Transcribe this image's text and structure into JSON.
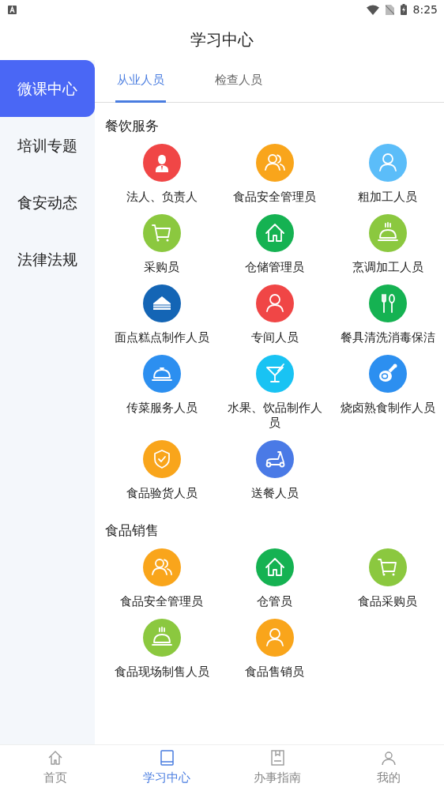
{
  "status_bar": {
    "time": "8:25"
  },
  "header": {
    "title": "学习中心"
  },
  "sidebar": {
    "items": [
      {
        "label": "微课中心",
        "selected": true
      },
      {
        "label": "培训专题",
        "selected": false
      },
      {
        "label": "食安动态",
        "selected": false
      },
      {
        "label": "法律法规",
        "selected": false
      }
    ]
  },
  "tabs": [
    {
      "label": "从业人员",
      "selected": true
    },
    {
      "label": "检查人员",
      "selected": false
    }
  ],
  "sections": [
    {
      "title": "餐饮服务",
      "items": [
        {
          "label": "法人、负责人",
          "kind": "manager",
          "color": "#f04646"
        },
        {
          "label": "食品安全管理员",
          "kind": "group",
          "color": "#f9a51b"
        },
        {
          "label": "粗加工人员",
          "kind": "person",
          "color": "#5bbdf9"
        },
        {
          "label": "采购员",
          "kind": "cart",
          "color": "#8bc83f"
        },
        {
          "label": "仓储管理员",
          "kind": "house",
          "color": "#15b252"
        },
        {
          "label": "烹调加工人员",
          "kind": "steam",
          "color": "#8bc83f"
        },
        {
          "label": "面点糕点制作人员",
          "kind": "cake",
          "color": "#1465b5"
        },
        {
          "label": "专间人员",
          "kind": "person",
          "color": "#f04646"
        },
        {
          "label": "餐具清洗消毒保洁",
          "kind": "utensils",
          "color": "#15b252"
        },
        {
          "label": "传菜服务人员",
          "kind": "cloche",
          "color": "#2c8ff0"
        },
        {
          "label": "水果、饮品制作人员",
          "kind": "cocktail",
          "color": "#19c3f3"
        },
        {
          "label": "烧卤熟食制作人员",
          "kind": "ham",
          "color": "#2c8ff0"
        },
        {
          "label": "食品验货人员",
          "kind": "shield",
          "color": "#f9a51b"
        },
        {
          "label": "送餐人员",
          "kind": "scooter",
          "color": "#4a7ae6"
        }
      ]
    },
    {
      "title": "食品销售",
      "items": [
        {
          "label": "食品安全管理员",
          "kind": "group",
          "color": "#f9a51b"
        },
        {
          "label": "仓管员",
          "kind": "house",
          "color": "#15b252"
        },
        {
          "label": "食品采购员",
          "kind": "cart",
          "color": "#8bc83f"
        },
        {
          "label": "食品现场制售人员",
          "kind": "steam",
          "color": "#8bc83f"
        },
        {
          "label": "食品售销员",
          "kind": "person",
          "color": "#f9a51b"
        }
      ]
    }
  ],
  "bottom_nav": [
    {
      "label": "首页",
      "kind": "home",
      "selected": false
    },
    {
      "label": "学习中心",
      "kind": "book",
      "selected": true
    },
    {
      "label": "办事指南",
      "kind": "guide",
      "selected": false
    },
    {
      "label": "我的",
      "kind": "user",
      "selected": false
    }
  ]
}
